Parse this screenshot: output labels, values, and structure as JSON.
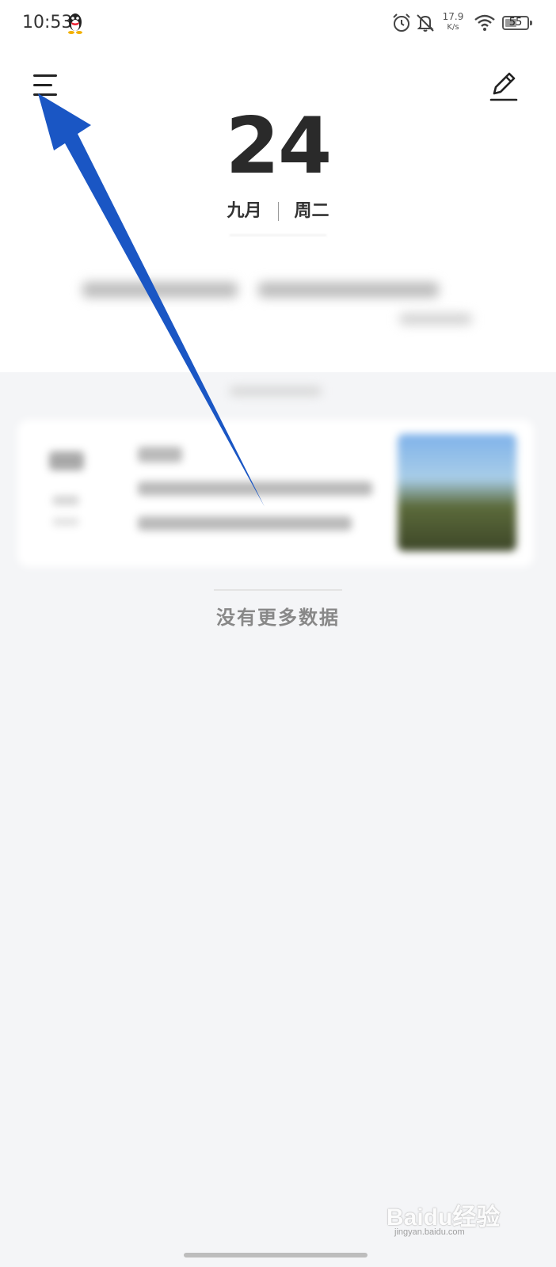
{
  "status_bar": {
    "time": "10:53",
    "net_speed_value": "17.9",
    "net_speed_unit": "K/s",
    "battery": "55",
    "battery_level_percent": 55,
    "icons": [
      "qq-penguin-icon",
      "alarm-icon",
      "bell-off-icon",
      "wifi-icon",
      "battery-icon"
    ]
  },
  "header": {
    "menu_icon": "hamburger-menu-icon",
    "edit_icon": "pencil-edit-icon"
  },
  "date": {
    "day": "24",
    "month": "九月",
    "weekday": "周二"
  },
  "feed": {
    "empty_message": "没有更多数据"
  },
  "watermark": {
    "brand": "Baidu经验",
    "url": "jingyan.baidu.com"
  },
  "colors": {
    "background": "#f4f5f7",
    "annotation_arrow": "#1a56c4",
    "text_primary": "#2a2a2a",
    "text_muted": "#888888"
  }
}
